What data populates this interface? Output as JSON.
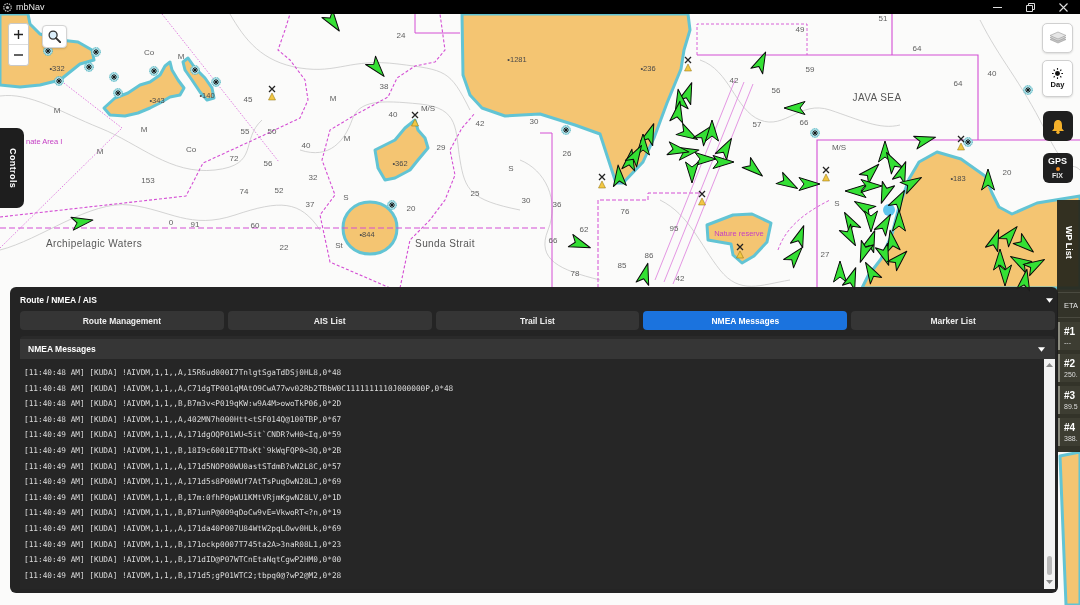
{
  "window": {
    "title": "mbNav"
  },
  "map": {
    "labels": [
      {
        "text": "51",
        "kind": "depth"
      },
      {
        "text": "49",
        "kind": "depth"
      },
      {
        "text": "24",
        "kind": "depth"
      },
      {
        "text": "Co",
        "kind": "depth"
      },
      {
        "text": "M",
        "kind": "depth"
      },
      {
        "text": "•1281",
        "kind": "height"
      },
      {
        "text": "64",
        "kind": "depth"
      },
      {
        "text": "•332",
        "kind": "height"
      },
      {
        "text": "•236",
        "kind": "height"
      },
      {
        "text": "59",
        "kind": "depth"
      },
      {
        "text": "40",
        "kind": "depth"
      },
      {
        "text": "38",
        "kind": "depth"
      },
      {
        "text": "42",
        "kind": "depth"
      },
      {
        "text": "56",
        "kind": "depth"
      },
      {
        "text": "64",
        "kind": "depth"
      },
      {
        "text": "•343",
        "kind": "height"
      },
      {
        "text": "•140",
        "kind": "height"
      },
      {
        "text": "45",
        "kind": "depth"
      },
      {
        "text": "M",
        "kind": "depth"
      },
      {
        "text": "JAVA SEA",
        "kind": "area"
      },
      {
        "text": "M",
        "kind": "depth"
      },
      {
        "text": "40",
        "kind": "depth"
      },
      {
        "text": "M/S",
        "kind": "depth"
      },
      {
        "text": "42",
        "kind": "depth"
      },
      {
        "text": "30",
        "kind": "depth"
      },
      {
        "text": "57",
        "kind": "depth"
      },
      {
        "text": "66",
        "kind": "depth"
      },
      {
        "text": "M",
        "kind": "depth"
      },
      {
        "text": "55",
        "kind": "depth"
      },
      {
        "text": "50",
        "kind": "depth"
      },
      {
        "text": "nate Area I",
        "kind": "note"
      },
      {
        "text": "M",
        "kind": "depth"
      },
      {
        "text": "Co",
        "kind": "depth"
      },
      {
        "text": "40",
        "kind": "depth"
      },
      {
        "text": "M",
        "kind": "depth"
      },
      {
        "text": "29",
        "kind": "depth"
      },
      {
        "text": "26",
        "kind": "depth"
      },
      {
        "text": "M/S",
        "kind": "depth"
      },
      {
        "text": "72",
        "kind": "depth"
      },
      {
        "text": "56",
        "kind": "depth"
      },
      {
        "text": "•362",
        "kind": "height"
      },
      {
        "text": "S",
        "kind": "depth"
      },
      {
        "text": "20",
        "kind": "depth"
      },
      {
        "text": "153",
        "kind": "depth"
      },
      {
        "text": "32",
        "kind": "depth"
      },
      {
        "text": "•183",
        "kind": "height"
      },
      {
        "text": "74",
        "kind": "depth"
      },
      {
        "text": "52",
        "kind": "depth"
      },
      {
        "text": "37",
        "kind": "depth"
      },
      {
        "text": "S",
        "kind": "depth"
      },
      {
        "text": "20",
        "kind": "depth"
      },
      {
        "text": "25",
        "kind": "depth"
      },
      {
        "text": "30",
        "kind": "depth"
      },
      {
        "text": "36",
        "kind": "depth"
      },
      {
        "text": "76",
        "kind": "depth"
      },
      {
        "text": "S",
        "kind": "depth"
      },
      {
        "text": "0",
        "kind": "depth"
      },
      {
        "text": "91",
        "kind": "depth"
      },
      {
        "text": "60",
        "kind": "depth"
      },
      {
        "text": "•844",
        "kind": "height"
      },
      {
        "text": "62",
        "kind": "depth"
      },
      {
        "text": "95",
        "kind": "depth"
      },
      {
        "text": "Nature reserve",
        "kind": "note"
      },
      {
        "text": "Archipelagic Waters",
        "kind": "area"
      },
      {
        "text": "22",
        "kind": "depth"
      },
      {
        "text": "St",
        "kind": "depth"
      },
      {
        "text": "Sunda Strait",
        "kind": "area"
      },
      {
        "text": "66",
        "kind": "depth"
      },
      {
        "text": "86",
        "kind": "depth"
      },
      {
        "text": "27",
        "kind": "depth"
      },
      {
        "text": "85",
        "kind": "depth"
      },
      {
        "text": "78",
        "kind": "depth"
      },
      {
        "text": "42",
        "kind": "depth"
      }
    ]
  },
  "controls_tab": {
    "label": "Controls"
  },
  "day_button": {
    "label": "Day"
  },
  "gps_button": {
    "label": "GPS",
    "status": "FIX"
  },
  "wp_list": {
    "title": "WP List",
    "column": "ETA",
    "waypoints": [
      {
        "name": "#1",
        "eta": "---"
      },
      {
        "name": "#2",
        "eta": "250."
      },
      {
        "name": "#3",
        "eta": "89.5"
      },
      {
        "name": "#4",
        "eta": "388."
      }
    ]
  },
  "panel": {
    "title": "Route / NMEA / AIS",
    "tabs": [
      {
        "label": "Route Management",
        "selected": false
      },
      {
        "label": "AIS List",
        "selected": false
      },
      {
        "label": "Trail List",
        "selected": false
      },
      {
        "label": "NMEA Messages",
        "selected": true
      },
      {
        "label": "Marker List",
        "selected": false
      }
    ],
    "section": {
      "title": "NMEA Messages",
      "messages": [
        "[11:40:48 AM] [KUDA] !AIVDM,1,1,,A,15R6ud000I7TnlgtSgaTdDSj0HL8,0*48",
        "[11:40:48 AM] [KUDA] !AIVDM,1,1,,A,C71dgTP001qMAtO9CwA77wv02Rb2TBbW0C1111111110J000000P,0*48",
        "[11:40:48 AM] [KUDA] !AIVDM,1,1,,B,B7m3v<P019qKW:w9A4M>owoTkP06,0*2D",
        "[11:40:48 AM] [KUDA] !AIVDM,1,1,,A,402MN7h000Htt<tSF014Q@100TBP,0*67",
        "[11:40:49 AM] [KUDA] !AIVDM,1,1,,A,171dgOQP01WU<5it`CNDR?wH0<Iq,0*59",
        "[11:40:49 AM] [KUDA] !AIVDM,1,1,,B,18I9c6001E7TDsKt`9kWqFQP0<3Q,0*2B",
        "[11:40:49 AM] [KUDA] !AIVDM,1,1,,A,171d5NOP00WU0astSTdmB?wN2L8C,0*57",
        "[11:40:49 AM] [KUDA] !AIVDM,1,1,,A,171d5s8P00WUf7AtTsPuqOwN28LJ,0*69",
        "[11:40:49 AM] [KUDA] !AIVDM,1,1,,B,17m:0fhP0pWU1KMtVRjmKgwN28LV,0*1D",
        "[11:40:49 AM] [KUDA] !AIVDM,1,1,,B,B71unP@009qDoCw9vE=VkwoRT<?n,0*19",
        "[11:40:49 AM] [KUDA] !AIVDM,1,1,,A,171da40P007U84WtW2pqLOwv0HLk,0*69",
        "[11:40:49 AM] [KUDA] !AIVDM,1,1,,B,171ockp0007T745ta2A>3naR08L1,0*23",
        "[11:40:49 AM] [KUDA] !AIVDM,1,1,,B,171dID@P07WTCnEtaNqtCgwP2HM0,0*00",
        "[11:40:49 AM] [KUDA] !AIVDM,1,1,,B,171d5;gP01WTC2;tbpq0@?wP2@M2,0*28"
      ]
    }
  }
}
